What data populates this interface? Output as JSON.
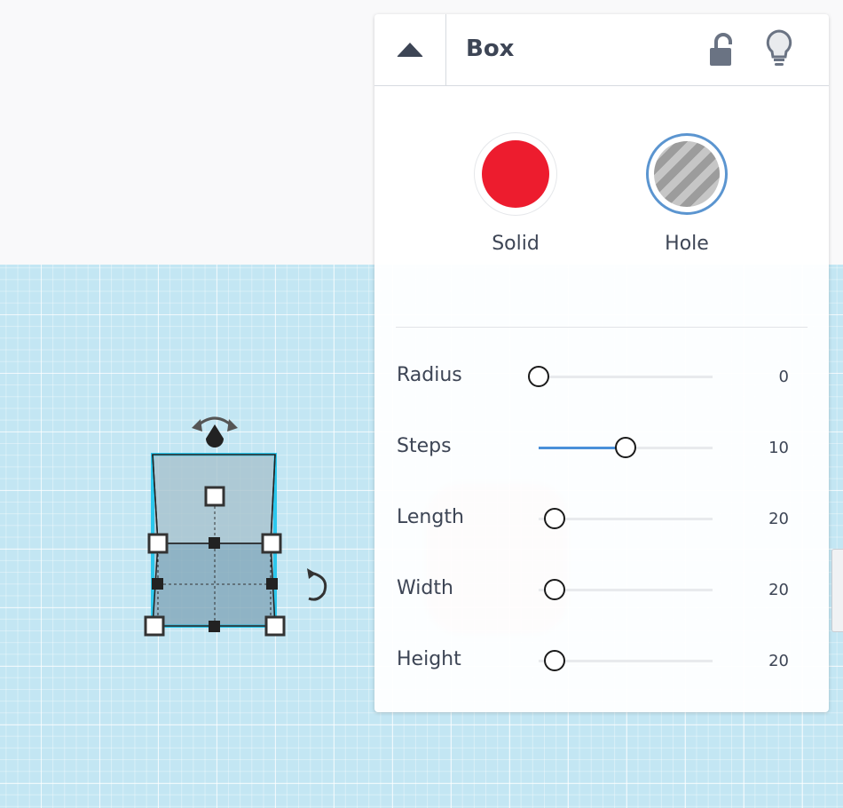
{
  "inspector": {
    "title": "Box",
    "collapse_icon": "triangle-up-icon",
    "lock_icon": "unlocked-padlock-icon",
    "light_icon": "lightbulb-icon",
    "modes": [
      {
        "label": "Solid",
        "color": "#ed1c2e",
        "selected": false
      },
      {
        "label": "Hole",
        "selected": true,
        "ring_color": "#5b95d0"
      }
    ],
    "params": [
      {
        "label": "Radius",
        "value": "0",
        "fraction": 0.0
      },
      {
        "label": "Steps",
        "value": "10",
        "fraction": 0.5
      },
      {
        "label": "Length",
        "value": "20",
        "fraction": 0.09
      },
      {
        "label": "Width",
        "value": "20",
        "fraction": 0.09
      },
      {
        "label": "Height",
        "value": "20",
        "fraction": 0.09
      }
    ],
    "accent_color": "#4a90d9"
  },
  "workplane": {
    "grid_color": "#c3e6f3",
    "selection_outline_color": "#25c2ea"
  }
}
